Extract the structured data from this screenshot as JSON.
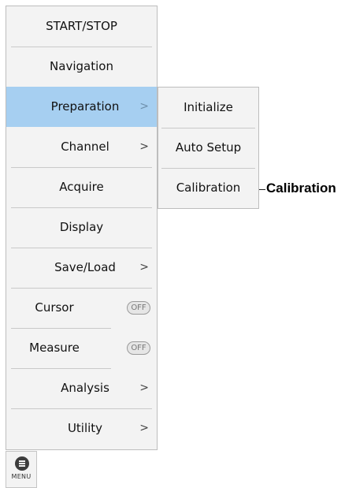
{
  "menu": {
    "items": [
      {
        "label": "START/STOP"
      },
      {
        "label": "Navigation"
      },
      {
        "label": "Preparation",
        "arrow": ">"
      },
      {
        "label": "Channel",
        "arrow": ">"
      },
      {
        "label": "Acquire"
      },
      {
        "label": "Display"
      },
      {
        "label": "Save/Load",
        "arrow": ">"
      },
      {
        "label": "Cursor",
        "state": "OFF"
      },
      {
        "label": "Measure",
        "state": "OFF"
      },
      {
        "label": "Analysis",
        "arrow": ">"
      },
      {
        "label": "Utility",
        "arrow": ">"
      }
    ],
    "selected": "Preparation"
  },
  "submenu": {
    "items": [
      {
        "label": "Initialize"
      },
      {
        "label": "Auto Setup"
      },
      {
        "label": "Calibration"
      }
    ]
  },
  "callout": {
    "text": "Calibration"
  },
  "menu_button": {
    "label": "MENU",
    "icon": "menu-icon"
  },
  "colors": {
    "selected": "#a6cff1",
    "panel": "#f3f3f3"
  }
}
